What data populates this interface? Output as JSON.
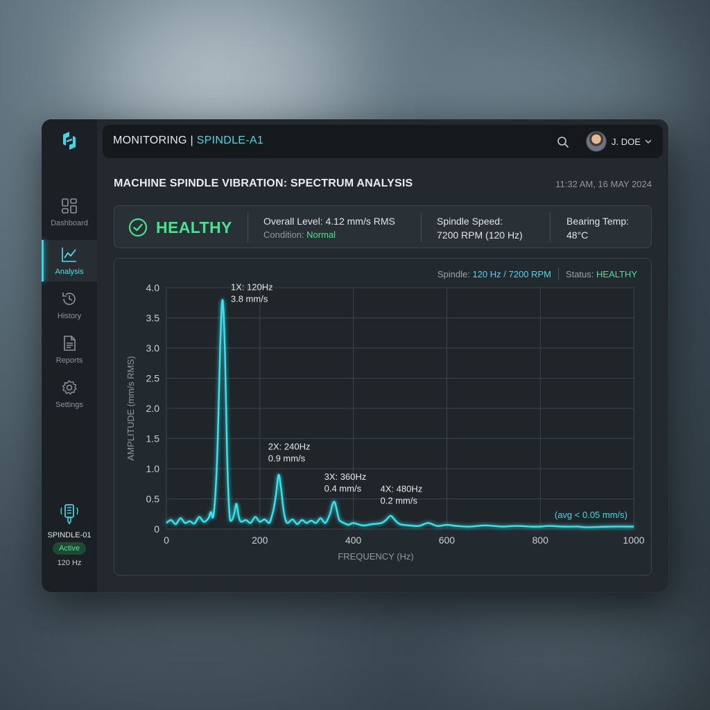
{
  "topbar": {
    "section": "MONITORING",
    "separator": "|",
    "machine": "SPINDLE-A1",
    "search_icon": "search-icon",
    "user_name": "J. DOE"
  },
  "sidebar": {
    "items": [
      {
        "label": "Dashboard",
        "icon": "dashboard-icon",
        "active": false
      },
      {
        "label": "Analysis",
        "icon": "analysis-icon",
        "active": true
      },
      {
        "label": "History",
        "icon": "history-icon",
        "active": false
      },
      {
        "label": "Reports",
        "icon": "reports-icon",
        "active": false
      },
      {
        "label": "Settings",
        "icon": "gear-icon",
        "active": false
      }
    ],
    "device": {
      "name": "SPINDLE-01",
      "status": "Active",
      "freq": "120 Hz"
    }
  },
  "page": {
    "title": "MACHINE SPINDLE VIBRATION: SPECTRUM ANALYSIS",
    "timestamp": "11:32 AM, 16 MAY 2024"
  },
  "status_card": {
    "health": "HEALTHY",
    "overall_label": "Overall Level:",
    "overall_value": "4.12 mm/s RMS",
    "condition_label": "Condition:",
    "condition_value": "Normal",
    "speed_label": "Spindle Speed:",
    "speed_value": "7200 RPM (120 Hz)",
    "temp_label": "Bearing Temp:",
    "temp_value": "48°C"
  },
  "chart_header": {
    "spindle_label": "Spindle:",
    "spindle_value": "120 Hz / 7200 RPM",
    "status_label": "Status:",
    "status_value": "HEALTHY"
  },
  "colors": {
    "accent": "#46d9e6",
    "healthy": "#45e58e",
    "trace": "#35e6f0"
  },
  "chart_data": {
    "type": "line",
    "xlabel": "FREQUENCY (Hz)",
    "ylabel": "AMPLITUDE (mm/s RMS)",
    "xlim": [
      0,
      1000
    ],
    "ylim": [
      0,
      4.0
    ],
    "xticks": [
      0,
      200,
      400,
      600,
      800,
      1000
    ],
    "yticks": [
      0,
      0.5,
      1.0,
      1.5,
      2.0,
      2.5,
      3.0,
      3.5,
      4.0
    ],
    "ytick_labels": [
      "0",
      "0.5",
      "1.0",
      "1.5",
      "2.0",
      "2.5",
      "3.0",
      "3.5",
      "4.0"
    ],
    "grid": true,
    "x": [
      0,
      10,
      20,
      30,
      40,
      50,
      60,
      70,
      80,
      90,
      95,
      100,
      105,
      110,
      115,
      120,
      125,
      130,
      135,
      140,
      145,
      150,
      155,
      160,
      170,
      180,
      190,
      200,
      210,
      220,
      225,
      230,
      235,
      240,
      245,
      250,
      255,
      260,
      270,
      280,
      290,
      300,
      310,
      320,
      330,
      340,
      350,
      355,
      360,
      365,
      370,
      380,
      390,
      400,
      420,
      440,
      460,
      470,
      480,
      490,
      500,
      520,
      540,
      560,
      580,
      600,
      620,
      650,
      680,
      700,
      720,
      750,
      780,
      800,
      820,
      850,
      880,
      900,
      950,
      1000
    ],
    "y": [
      0.1,
      0.15,
      0.08,
      0.18,
      0.1,
      0.13,
      0.09,
      0.2,
      0.12,
      0.18,
      0.28,
      0.2,
      0.6,
      1.5,
      3.0,
      3.8,
      3.0,
      1.2,
      0.25,
      0.15,
      0.25,
      0.42,
      0.2,
      0.12,
      0.15,
      0.1,
      0.2,
      0.12,
      0.16,
      0.1,
      0.2,
      0.35,
      0.6,
      0.9,
      0.7,
      0.35,
      0.15,
      0.1,
      0.16,
      0.08,
      0.15,
      0.1,
      0.14,
      0.1,
      0.18,
      0.1,
      0.25,
      0.4,
      0.45,
      0.3,
      0.15,
      0.1,
      0.07,
      0.1,
      0.06,
      0.08,
      0.1,
      0.15,
      0.22,
      0.14,
      0.08,
      0.06,
      0.05,
      0.1,
      0.05,
      0.07,
      0.05,
      0.04,
      0.06,
      0.05,
      0.04,
      0.05,
      0.04,
      0.04,
      0.05,
      0.04,
      0.04,
      0.03,
      0.04,
      0.04
    ],
    "annotations": [
      {
        "label": "1X: 120Hz",
        "value": "3.8 mm/s",
        "x": 120,
        "y": 3.8
      },
      {
        "label": "2X: 240Hz",
        "value": "0.9 mm/s",
        "x": 240,
        "y": 0.9
      },
      {
        "label": "3X: 360Hz",
        "value": "0.4 mm/s",
        "x": 360,
        "y": 0.4
      },
      {
        "label": "4X: 480Hz",
        "value": "0.2 mm/s",
        "x": 480,
        "y": 0.2
      }
    ],
    "floor_note": "(avg < 0.05 mm/s)"
  }
}
